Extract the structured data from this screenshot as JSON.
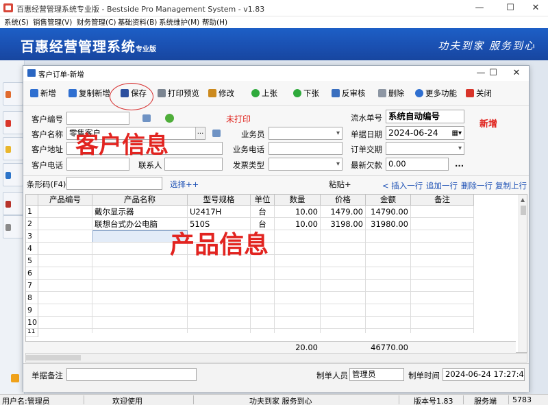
{
  "app": {
    "title": "百惠经营管理系统专业版 - Bestside Pro Management System - v1.83",
    "minimize": "—",
    "maximize": "☐",
    "close": "✕"
  },
  "menu": [
    "系统(S)",
    "销售管理(V)",
    "财务管理(C)",
    "基础资料(B)",
    "系统维护(M)",
    "帮助(H)"
  ],
  "banner": {
    "brand": "百惠经营管理系统",
    "brand_small": "专业版",
    "slogan": "功夫到家 服务到心"
  },
  "dialog": {
    "title": "客户订单-新增",
    "minimize": "—",
    "maximize": "☐",
    "close": "✕"
  },
  "toolbar": {
    "new": "新增",
    "copy_new": "复制新增",
    "save": "保存",
    "print_preview": "打印预览",
    "edit": "修改",
    "prev": "上张",
    "next": "下张",
    "unaudit": "反审核",
    "delete": "删除",
    "more": "更多功能",
    "close": "关闭"
  },
  "form": {
    "customer_code_label": "客户编号",
    "customer_code": "",
    "print_status": "未打印",
    "serial_label": "流水单号",
    "serial": "系统自动编号",
    "mode": "新增",
    "customer_name_label": "客户名称",
    "customer_name": "零售客户",
    "salesperson_label": "业务员",
    "salesperson": "",
    "date_label": "单据日期",
    "date": "2024-06-24",
    "address_label": "客户地址",
    "address": "",
    "biz_phone_label": "业务电话",
    "biz_phone": "",
    "delivery_label": "订单交期",
    "delivery": "",
    "phone_label": "客户电话",
    "phone": "",
    "contact_label": "联系人",
    "contact": "",
    "invoice_label": "发票类型",
    "invoice": "",
    "debt_label": "最新欠款",
    "debt": "0.00",
    "ellipsis": "...",
    "more_btn": "...",
    "barcode_label": "条形码(F4)",
    "barcode": "",
    "select_link": "选择++",
    "paste": "粘贴+",
    "insert_row": "< 插入一行",
    "add_row": "追加一行",
    "delete_row": "删除一行",
    "copy_row": "复制上行"
  },
  "overlays": {
    "customer_info": "客户信息",
    "product_info": "产品信息"
  },
  "table": {
    "headers": [
      "产品编号",
      "产品名称",
      "型号规格",
      "单位",
      "数量",
      "价格",
      "金额",
      "备注"
    ],
    "rows": [
      [
        "",
        "戴尔显示器",
        "U2417H",
        "台",
        "10.00",
        "1479.00",
        "14790.00",
        ""
      ],
      [
        "",
        "联想台式办公电脑",
        "510S",
        "台",
        "10.00",
        "3198.00",
        "31980.00",
        ""
      ]
    ],
    "row_numbers": [
      "1",
      "2",
      "3",
      "4",
      "5",
      "6",
      "7",
      "8",
      "9",
      "10",
      "11"
    ],
    "total_qty": "20.00",
    "total_amount": "46770.00"
  },
  "footer": {
    "remark_label": "单据备注",
    "remark": "",
    "maker_label": "制单人员",
    "maker": "管理员",
    "time_label": "制单时间",
    "time": "2024-06-24 17:27:42"
  },
  "status": {
    "user": "用户名:管理员",
    "welcome": "欢迎使用",
    "slogan": "功夫到家 服务到心",
    "version": "版本号1.83",
    "server": "服务端",
    "extra": "5783"
  }
}
